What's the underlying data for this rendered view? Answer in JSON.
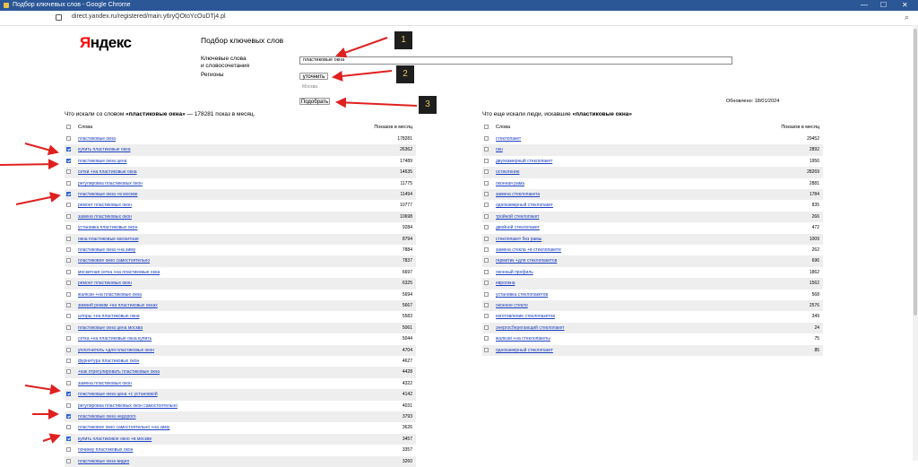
{
  "window": {
    "title": "Подбор ключевых слов - Google Chrome",
    "minimize": "—",
    "maximize": "☐",
    "close": "✕"
  },
  "address": {
    "url": "direct.yandex.ru/registered/main.y6ryQOtoYcOuDTj4.pl",
    "zoom_icon": "search-icon"
  },
  "logo": {
    "first": "Я",
    "rest": "ндекс"
  },
  "page_title": "Подбор ключевых слов",
  "form": {
    "keywords_label_1": "Ключевые слова",
    "keywords_label_2": "и словосочетания",
    "keywords_value": "пластиковые окна",
    "regions_label": "Регионы",
    "refine_button": "уточнить",
    "region_value": "Москва",
    "submit_button": "Подобрать"
  },
  "updated": "Обновлено: 18/01/2024",
  "annotations": [
    "1",
    "2",
    "3"
  ],
  "left_panel": {
    "title_prefix": "Что искали со словом ",
    "title_bold": "«пластиковые окна»",
    "title_suffix": " — 178281 показ в месяц.",
    "col_words": "Слова",
    "col_shows": "Показов в месяц",
    "rows": [
      {
        "kw": "пластиковые окна",
        "count": "178281",
        "checked": false
      },
      {
        "kw": "купить пластиковые окна",
        "count": "26362",
        "checked": true
      },
      {
        "kw": "пластиковые окна цена",
        "count": "17489",
        "checked": true
      },
      {
        "kw": "сетки +на пластиковые окна",
        "count": "14635",
        "checked": false
      },
      {
        "kw": "регулировка пластиковых окон",
        "count": "11775",
        "checked": false
      },
      {
        "kw": "пластиковые окна +в москве",
        "count": "11494",
        "checked": true
      },
      {
        "kw": "ремонт пластиковых окон",
        "count": "10777",
        "checked": false
      },
      {
        "kw": "замена пластиковых окон",
        "count": "10698",
        "checked": false
      },
      {
        "kw": "установка пластиковых окон",
        "count": "9284",
        "checked": false
      },
      {
        "kw": "окна пластиковые москитная",
        "count": "8794",
        "checked": false
      },
      {
        "kw": "пластиковые окна +на зиму",
        "count": "7884",
        "checked": false
      },
      {
        "kw": "пластиковое окно самостоятельно",
        "count": "7837",
        "checked": false
      },
      {
        "kw": "москитная сетка +на пластиковые окна",
        "count": "6697",
        "checked": false
      },
      {
        "kw": "ремонт пластиковых окон",
        "count": "6325",
        "checked": false
      },
      {
        "kw": "жалюзи +на пластиковые окна",
        "count": "5694",
        "checked": false
      },
      {
        "kw": "зимний режим +на пластиковых окнах",
        "count": "5667",
        "checked": false
      },
      {
        "kw": "шторы +на пластиковые окна",
        "count": "5583",
        "checked": false
      },
      {
        "kw": "пластиковые окна цена москва",
        "count": "5061",
        "checked": false
      },
      {
        "kw": "сетка +на пластиковые окна купить",
        "count": "5044",
        "checked": false
      },
      {
        "kw": "уплотнитель +для пластиковых окон",
        "count": "4704",
        "checked": false
      },
      {
        "kw": "фурнитура пластиковых окон",
        "count": "4627",
        "checked": false
      },
      {
        "kw": "+как отрегулировать пластиковые окна",
        "count": "4428",
        "checked": false
      },
      {
        "kw": "замена пластиковых окон",
        "count": "4322",
        "checked": false
      },
      {
        "kw": "пластиковые окна цена +с установкой",
        "count": "4142",
        "checked": true
      },
      {
        "kw": "регулировка пластиковых окон самостоятельно",
        "count": "4031",
        "checked": false
      },
      {
        "kw": "пластиковые окна недорого",
        "count": "3793",
        "checked": true
      },
      {
        "kw": "пластиковое окно самостоятельно +на зиму",
        "count": "3626",
        "checked": false
      },
      {
        "kw": "купить пластиковое окно +в москве",
        "count": "3457",
        "checked": true
      },
      {
        "kw": "починку пластиковых окон",
        "count": "3357",
        "checked": false
      },
      {
        "kw": "пластиковые окна видео",
        "count": "3260",
        "checked": false
      }
    ]
  },
  "right_panel": {
    "title_prefix": "Что еще искали люди, искавшие ",
    "title_bold": "«пластиковые окна»",
    "col_words": "Слова",
    "col_shows": "Показов в месяц",
    "rows": [
      {
        "kw": "стеклопакет",
        "count": "29452"
      },
      {
        "kw": "окн",
        "count": "2892"
      },
      {
        "kw": "двухкамерный стеклопакет",
        "count": "1956"
      },
      {
        "kw": "остекление",
        "count": "28269"
      },
      {
        "kw": "оконная рама",
        "count": "2881"
      },
      {
        "kw": "замена стеклопакета",
        "count": "1784"
      },
      {
        "kw": "однокамерный стеклопакет",
        "count": "835"
      },
      {
        "kw": "тройной стеклопакет",
        "count": "266"
      },
      {
        "kw": "двойной стеклопакет",
        "count": "472"
      },
      {
        "kw": "стеклопакет без рамы",
        "count": "1009"
      },
      {
        "kw": "замена стекла +в стеклопакете",
        "count": "262"
      },
      {
        "kw": "герметик +для стеклопакетов",
        "count": "696"
      },
      {
        "kw": "оконный профиль",
        "count": "1862"
      },
      {
        "kw": "евроокна",
        "count": "1562"
      },
      {
        "kw": "установка стеклопакетов",
        "count": "568"
      },
      {
        "kw": "оконное стекло",
        "count": "2576"
      },
      {
        "kw": "изготовление стеклопакетов",
        "count": "349"
      },
      {
        "kw": "энергосберегающий стеклопакет",
        "count": "24"
      },
      {
        "kw": "жалюзи +на стеклопакеты",
        "count": "75"
      },
      {
        "kw": "однокамерный стеклопакет",
        "count": "85"
      }
    ]
  }
}
